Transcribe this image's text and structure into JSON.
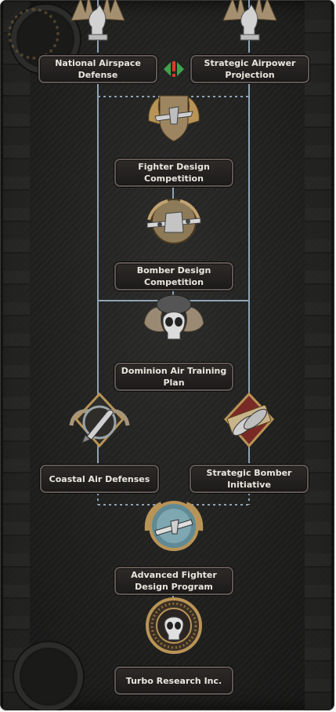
{
  "focus_tree": {
    "nodes": [
      {
        "id": "national_airspace_defense",
        "label": "National Airspace\nDefense",
        "icon": "chess-knight-wings-icon"
      },
      {
        "id": "strategic_airpower_projection",
        "label": "Strategic Airpower\nProjection",
        "icon": "chess-knight-wings-icon"
      },
      {
        "id": "fighter_design_competition",
        "label": "Fighter Design\nCompetition",
        "icon": "fighter-plane-icon"
      },
      {
        "id": "bomber_design_competition",
        "label": "Bomber Design\nCompetition",
        "icon": "bomber-plane-icon"
      },
      {
        "id": "dominion_air_training_plan",
        "label": "Dominion Air Training\nPlan",
        "icon": "winged-skull-icon"
      },
      {
        "id": "coastal_air_defenses",
        "label": "Coastal Air Defenses",
        "icon": "bomb-wings-icon"
      },
      {
        "id": "strategic_bomber_initiative",
        "label": "Strategic Bomber\nInitiative",
        "icon": "bombs-emblem-icon"
      },
      {
        "id": "advanced_fighter_design_program",
        "label": "Advanced Fighter\nDesign Program",
        "icon": "globe-plane-icon"
      },
      {
        "id": "turbo_research_inc",
        "label": "Turbo Research Inc.",
        "icon": "skull-medallion-icon"
      }
    ],
    "mutually_exclusive_icon": "exclusive-warning-icon",
    "colors": {
      "line": "#8fa3b5",
      "label_text": "#e9e6df",
      "label_border": "#5e5753",
      "gold": "#b89456",
      "silver": "#bfbfbf"
    }
  }
}
